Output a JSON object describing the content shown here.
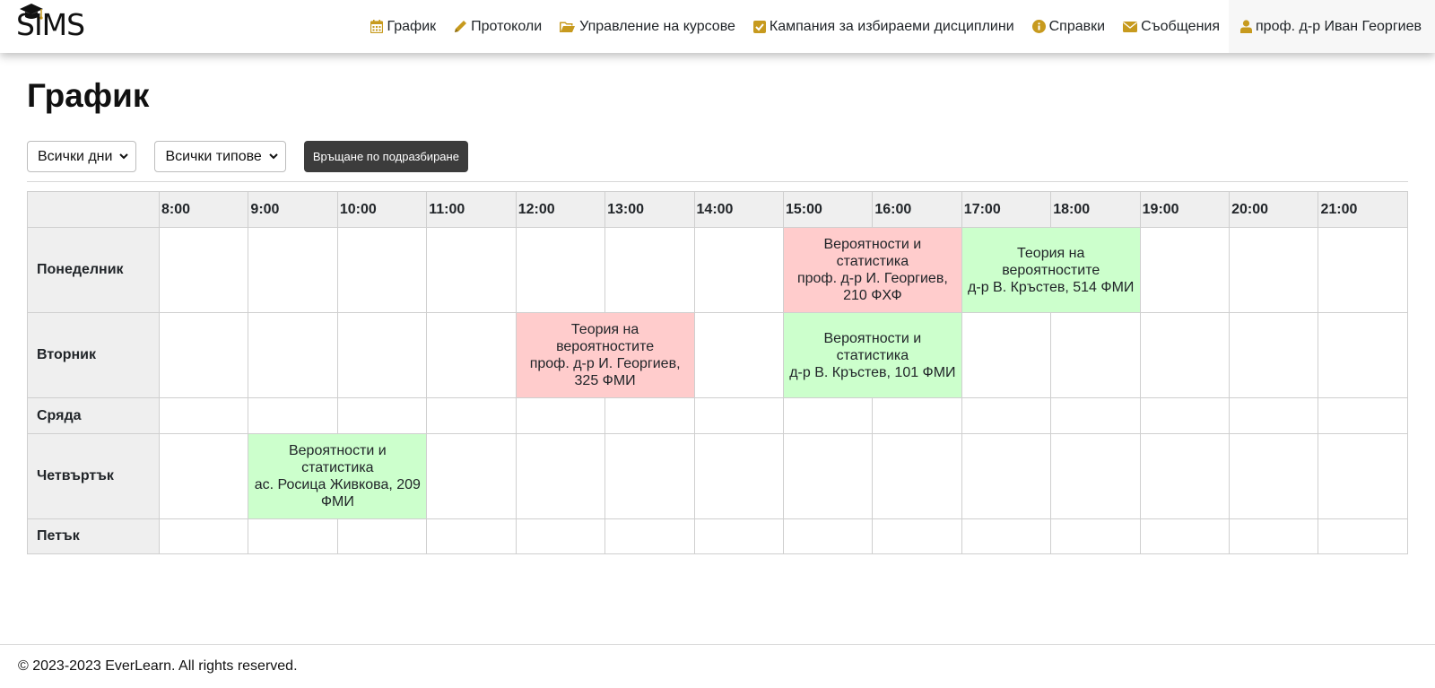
{
  "brand": {
    "logo_text": "SIMS"
  },
  "nav": {
    "items": [
      {
        "label": "График",
        "icon": "calendar-icon"
      },
      {
        "label": "Протоколи",
        "icon": "pencil-icon"
      },
      {
        "label": "Управление на курсове",
        "icon": "folder-open-icon"
      },
      {
        "label": "Кампания за избираеми дисциплини",
        "icon": "check-square-icon"
      },
      {
        "label": "Справки",
        "icon": "info-circle-icon"
      },
      {
        "label": "Съобщения",
        "icon": "envelope-icon"
      }
    ],
    "user": {
      "label": "проф. д-р Иван Георгиев",
      "icon": "user-icon"
    }
  },
  "page": {
    "title": "График",
    "filters": {
      "days": "Всички дни",
      "types": "Всички типове",
      "reset": "Връщане по подразбиране"
    }
  },
  "schedule": {
    "hours": [
      "8:00",
      "9:00",
      "10:00",
      "11:00",
      "12:00",
      "13:00",
      "14:00",
      "15:00",
      "16:00",
      "17:00",
      "18:00",
      "19:00",
      "20:00",
      "21:00"
    ],
    "days": [
      {
        "name": "Понеделник",
        "classes": [
          {
            "start": "15:00",
            "end": "17:00",
            "type": "lecture",
            "title": "Вероятности и статистика",
            "details": "проф. д-р И. Георгиев, 210 ФХФ"
          },
          {
            "start": "17:00",
            "end": "19:00",
            "type": "seminar",
            "title": "Теория на вероятностите",
            "details": "д-р В. Кръстев, 514 ФМИ"
          }
        ]
      },
      {
        "name": "Вторник",
        "classes": [
          {
            "start": "12:00",
            "end": "14:00",
            "type": "lecture",
            "title": "Теория на вероятностите",
            "details": "проф. д-р И. Георгиев, 325 ФМИ"
          },
          {
            "start": "15:00",
            "end": "17:00",
            "type": "seminar",
            "title": "Вероятности и статистика",
            "details": "д-р В. Кръстев, 101 ФМИ"
          }
        ]
      },
      {
        "name": "Сряда",
        "classes": []
      },
      {
        "name": "Четвъртък",
        "classes": [
          {
            "start": "9:00",
            "end": "11:00",
            "type": "seminar",
            "title": "Вероятности и статистика",
            "details": "ас. Росица Живкова, 209 ФМИ"
          }
        ]
      },
      {
        "name": "Петък",
        "classes": []
      }
    ]
  },
  "colors": {
    "lecture": "#ffcccc",
    "seminar": "#ccffcc",
    "accent": "#c79a1e"
  },
  "footer": {
    "text": "© 2023-2023 EverLearn. All rights reserved."
  }
}
